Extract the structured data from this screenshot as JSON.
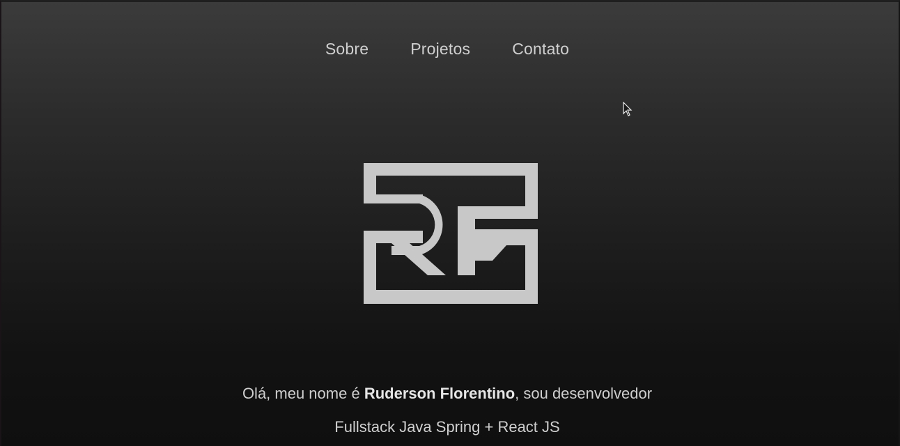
{
  "nav": {
    "items": [
      {
        "label": "Sobre"
      },
      {
        "label": "Projetos"
      },
      {
        "label": "Contato"
      }
    ]
  },
  "logo": {
    "text": "RF",
    "color": "#c8c8c8"
  },
  "intro": {
    "prefix": "Olá, meu nome é ",
    "name": "Ruderson Florentino",
    "suffix": ", sou desenvolvedor",
    "subline": "Fullstack Java Spring + React JS"
  },
  "colors": {
    "text": "#cfcfcf",
    "background_top": "#3b3b3b",
    "background_bottom": "#0f0f0f"
  }
}
